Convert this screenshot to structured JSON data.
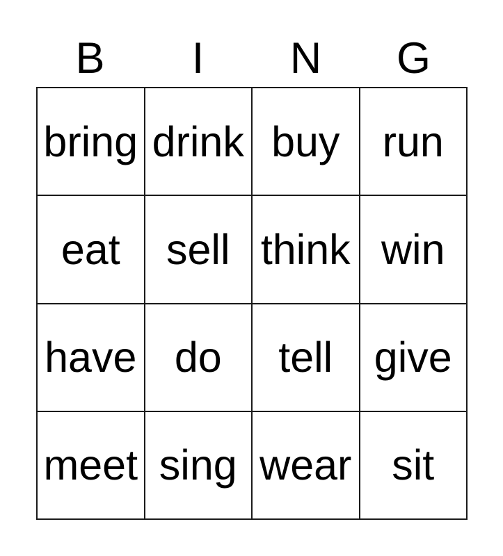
{
  "card": {
    "title": "BING",
    "background_color": "#ffffff",
    "line_color": "#1a1a1a",
    "text_color": "#000000"
  },
  "header": {
    "letters": [
      {
        "label": "B"
      },
      {
        "label": "I"
      },
      {
        "label": "N"
      },
      {
        "label": "G"
      }
    ]
  },
  "grid": {
    "columns": 4,
    "rows": 4,
    "cells": [
      [
        {
          "word": "bring"
        },
        {
          "word": "drink"
        },
        {
          "word": "buy"
        },
        {
          "word": "run"
        }
      ],
      [
        {
          "word": "eat"
        },
        {
          "word": "sell"
        },
        {
          "word": "think"
        },
        {
          "word": "win"
        }
      ],
      [
        {
          "word": "have"
        },
        {
          "word": "do"
        },
        {
          "word": "tell"
        },
        {
          "word": "give"
        }
      ],
      [
        {
          "word": "meet"
        },
        {
          "word": "sing"
        },
        {
          "word": "wear"
        },
        {
          "word": "sit"
        }
      ]
    ]
  }
}
